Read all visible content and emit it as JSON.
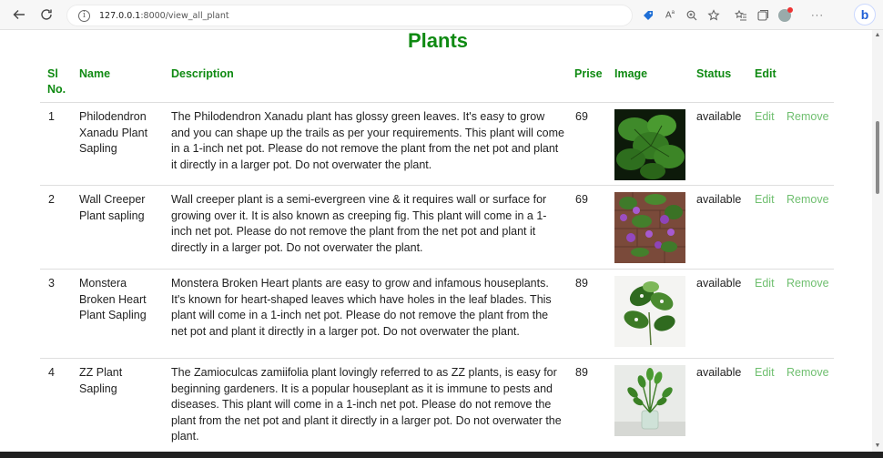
{
  "browser": {
    "url_host": "127.0.0.1",
    "url_path": ":8000/view_all_plant"
  },
  "page": {
    "title": "Plants"
  },
  "table": {
    "headers": {
      "sl": "Sl No.",
      "name": "Name",
      "description": "Description",
      "prise": "Prise",
      "image": "Image",
      "status": "Status",
      "edit": "Edit"
    },
    "rows": [
      {
        "sl": "1",
        "name": "Philodendron Xanadu Plant Sapling",
        "description": "The Philodendron Xanadu plant has glossy green leaves. It's easy to grow and you can shape up the trails as per your requirements. This plant will come in a 1-inch net pot. Please do not remove the plant from the net pot and plant it directly in a larger pot. Do not overwater the plant.",
        "prise": "69",
        "image": "philodendron-photo",
        "status": "available",
        "edit": "Edit",
        "remove": "Remove"
      },
      {
        "sl": "2",
        "name": "Wall Creeper Plant sapling",
        "description": "Wall creeper plant is a semi-evergreen vine & it requires wall or surface for growing over it. It is also known as creeping fig. This plant will come in a 1-inch net pot. Please do not remove the plant from the net pot and plant it directly in a larger pot. Do not overwater the plant.",
        "prise": "69",
        "image": "wall-creeper-photo",
        "status": "available",
        "edit": "Edit",
        "remove": "Remove"
      },
      {
        "sl": "3",
        "name": "Monstera Broken Heart Plant Sapling",
        "description": "Monstera Broken Heart plants are easy to grow and infamous houseplants. It's known for heart-shaped leaves which have holes in the leaf blades. This plant will come in a 1-inch net pot. Please do not remove the plant from the net pot and plant it directly in a larger pot. Do not overwater the plant.",
        "prise": "89",
        "image": "monstera-photo",
        "status": "available",
        "edit": "Edit",
        "remove": "Remove"
      },
      {
        "sl": "4",
        "name": "ZZ Plant Sapling",
        "description": "The Zamioculcas zamiifolia plant lovingly referred to as ZZ plants, is easy for beginning gardeners. It is a popular houseplant as it is immune to pests and diseases. This plant will come in a 1-inch net pot. Please do not remove the plant from the net pot and plant it directly in a larger pot. Do not overwater the plant.",
        "prise": "89",
        "image": "zz-plant-photo",
        "status": "available",
        "edit": "Edit",
        "remove": "Remove"
      }
    ]
  },
  "colors": {
    "heading_green": "#0f8a12",
    "link_green": "#6fbf6f"
  }
}
